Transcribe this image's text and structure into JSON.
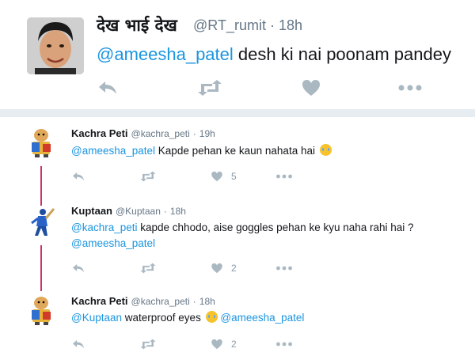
{
  "top_tweet": {
    "name": "देख भाई देख",
    "handle": "@RT_rumit",
    "time": "18h",
    "mention": "@ameesha_patel",
    "text": "desh ki nai poonam pandey",
    "icons": [
      "reply-icon",
      "retweet-icon",
      "like-icon",
      "more-icon"
    ]
  },
  "replies": [
    {
      "name": "Kachra Peti",
      "handle": "@kachra_peti",
      "time": "19h",
      "mention": "@ameesha_patel",
      "text": "Kapde pehan ke kaun nahata hai",
      "emoji": "crying-face-icon",
      "likes": "5"
    },
    {
      "name": "Kuptaan",
      "handle": "@Kuptaan",
      "time": "18h",
      "mention": "@kachra_peti",
      "text": "kapde chhodo, aise goggles pehan ke kyu naha rahi hai ?",
      "mention2": "@ameesha_patel",
      "likes": "2"
    },
    {
      "name": "Kachra Peti",
      "handle": "@kachra_peti",
      "time": "18h",
      "mention": "@Kuptaan",
      "text": "waterproof eyes",
      "emoji": "laughing-tears-icon",
      "mention2": "@ameesha_patel",
      "likes": "2"
    }
  ],
  "colors": {
    "mention": "#1b95e0",
    "thread_line": "#cc3366",
    "action_icon": "#8899a6",
    "background": "#e6ecf0"
  }
}
